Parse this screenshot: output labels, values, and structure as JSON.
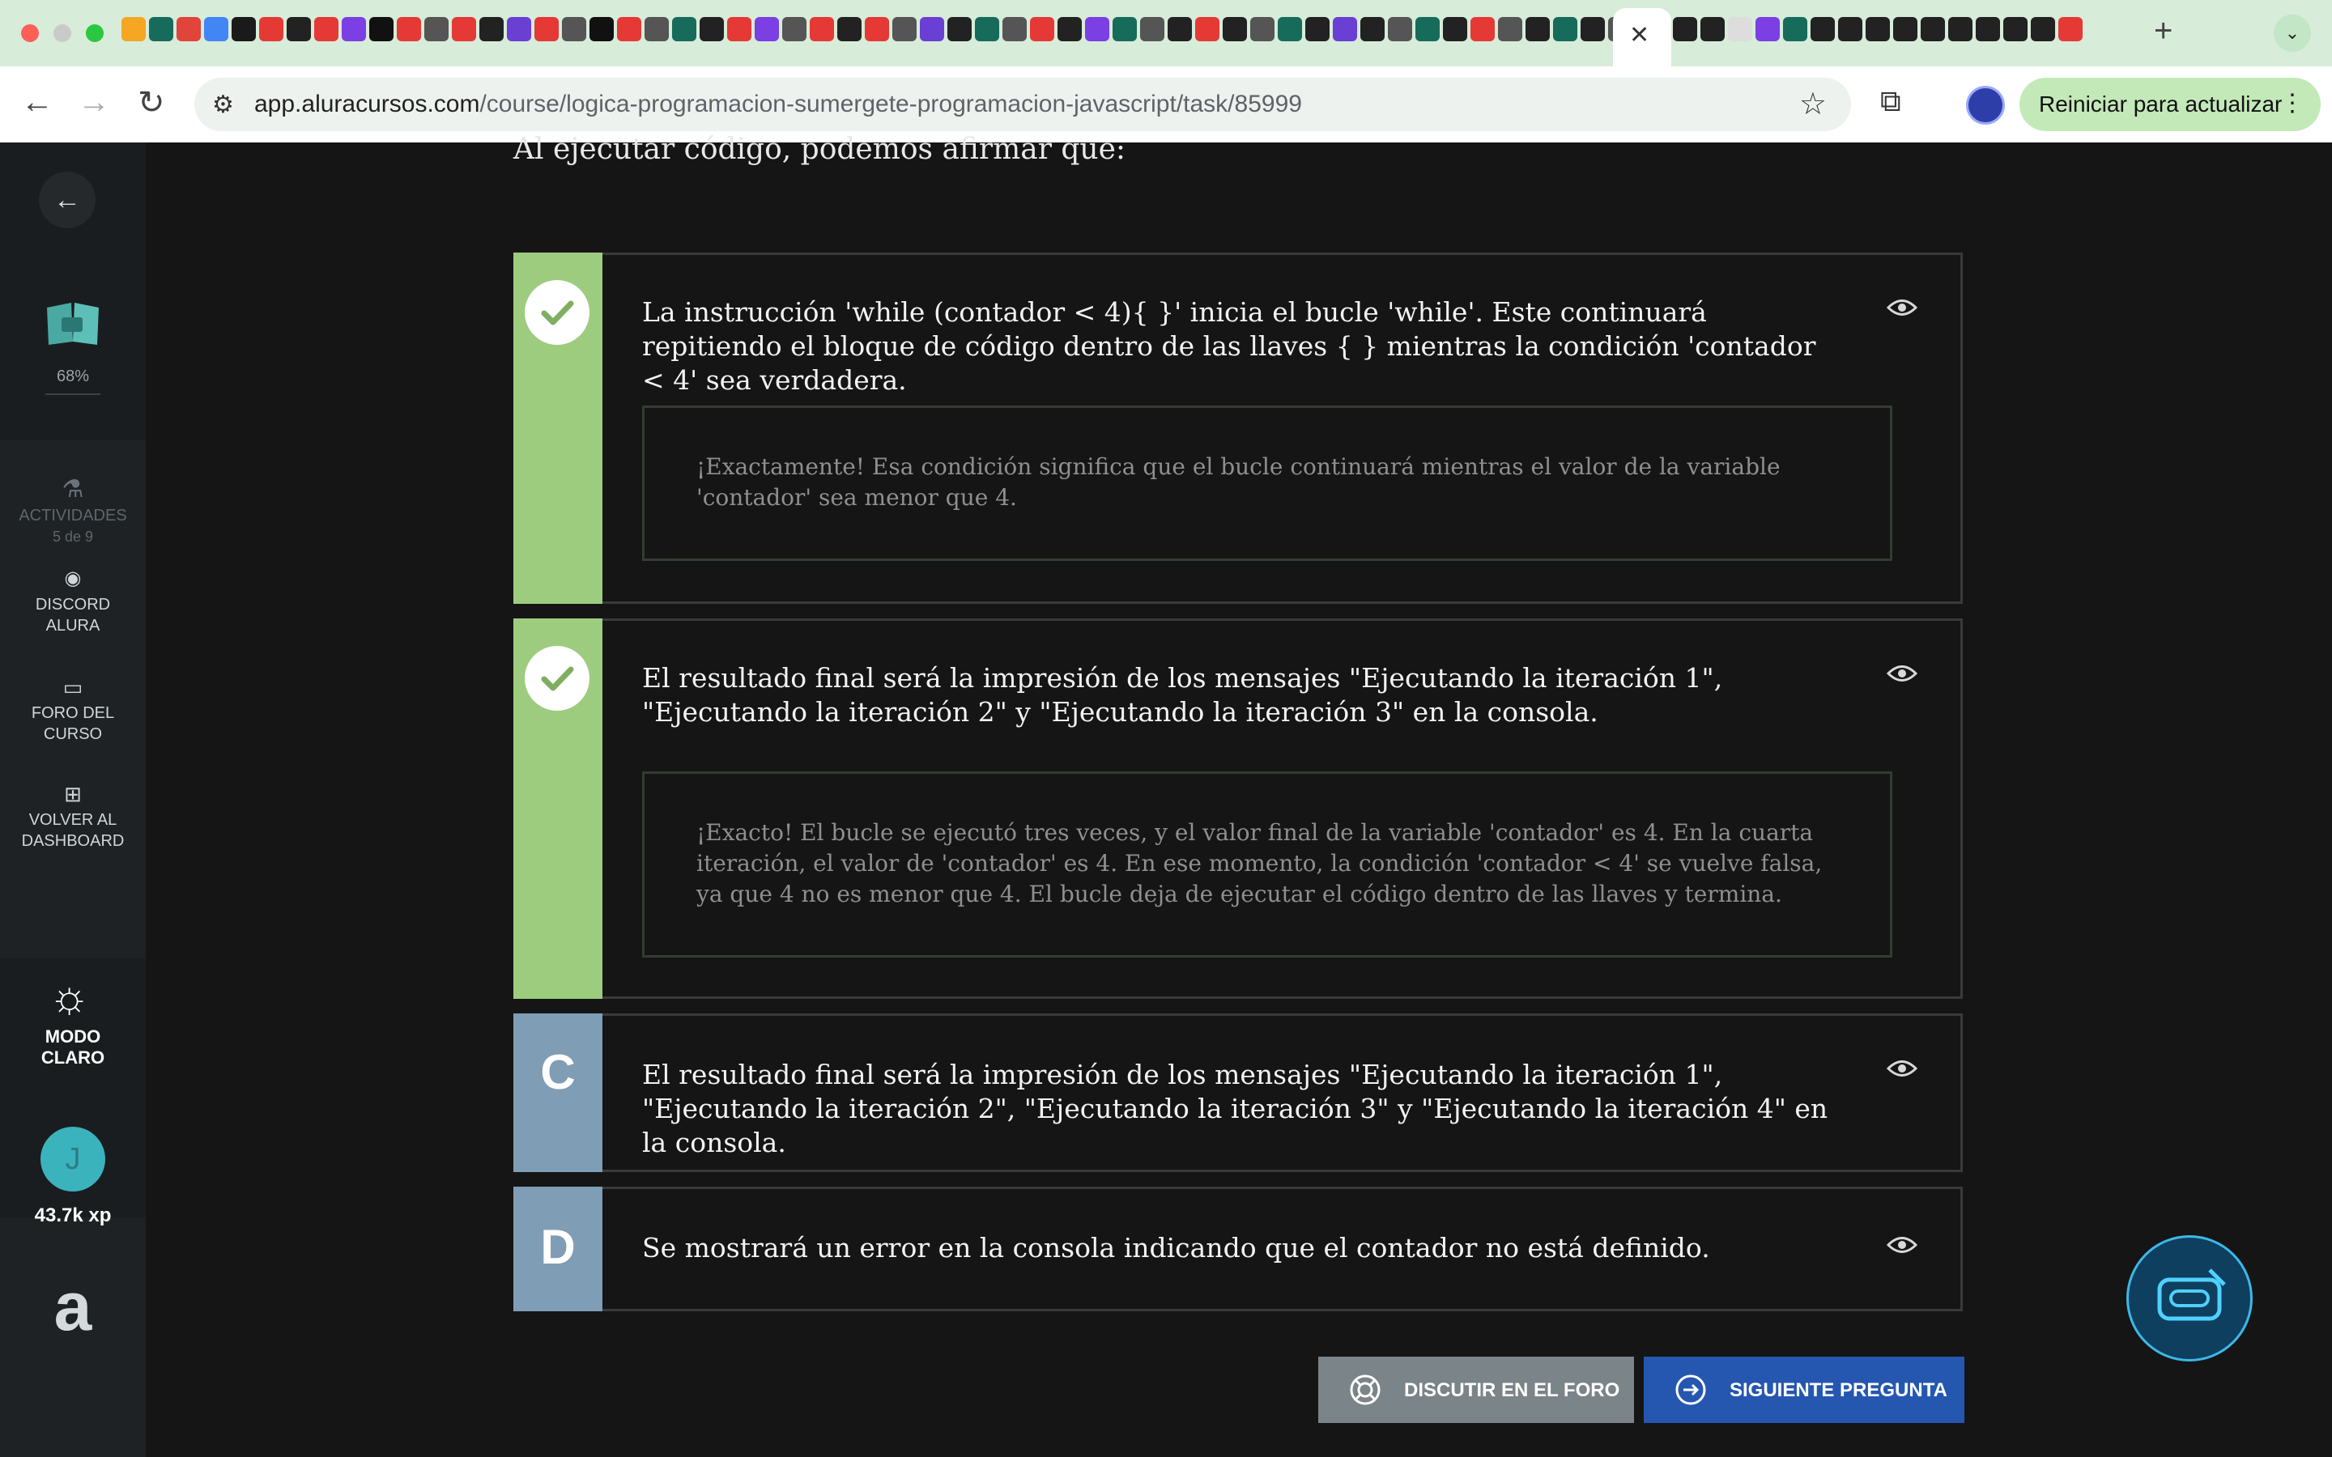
{
  "browser": {
    "url_host": "app.aluracursos.com",
    "url_path": "/course/logica-programacion-sumergete-programacion-javascript/task/85999",
    "restart_label": "Reiniciar para actualizar"
  },
  "sidebar": {
    "progress": "68%",
    "activities_label": "ACTIVIDADES",
    "activities_count": "5 de 9",
    "discord_label": "DISCORD ALURA",
    "forum_label": "FORO DEL CURSO",
    "dashboard_label": "VOLVER AL DASHBOARD",
    "mode_label": "MODO CLARO",
    "avatar_initial": "J",
    "xp": "43.7k xp",
    "logo": "a"
  },
  "question": {
    "prompt": "Al ejecutar código, podemos afirmar que:",
    "options": [
      {
        "marker": "",
        "text": "La instrucción 'while (contador < 4){ }' inicia el bucle 'while'. Este continuará repitiendo el bloque de código dentro de las llaves { } mientras la condición 'contador < 4' sea verdadera.",
        "feedback": "¡Exactamente! Esa condición significa que el bucle continuará mientras el valor de la variable 'contador' sea menor que 4.",
        "correct": true
      },
      {
        "marker": "",
        "text": "El resultado final será la impresión de los mensajes \"Ejecutando la iteración 1\", \"Ejecutando la iteración 2\" y \"Ejecutando la iteración 3\" en la consola.",
        "feedback": "¡Exacto! El bucle se ejecutó tres veces, y el valor final de la variable 'contador' es 4. En la cuarta iteración, el valor de 'contador' es 4. En ese momento, la condición 'contador < 4' se vuelve falsa, ya que 4 no es menor que 4. El bucle deja de ejecutar el código dentro de las llaves y termina.",
        "correct": true
      },
      {
        "marker": "C",
        "text": "El resultado final será la impresión de los mensajes \"Ejecutando la iteración 1\", \"Ejecutando la iteración 2\", \"Ejecutando la iteración 3\" y \"Ejecutando la iteración 4\" en la consola.",
        "feedback": "",
        "correct": false
      },
      {
        "marker": "D",
        "text": "Se mostrará un error en la consola indicando que el contador no está definido.",
        "feedback": "",
        "correct": false
      }
    ]
  },
  "actions": {
    "forum_button": "DISCUTIR EN EL FORO",
    "next_button": "SIGUIENTE PREGUNTA"
  },
  "colors": {
    "correct_green": "#9dcc7e",
    "letter_blue": "#7f9db5",
    "next_blue": "#2557b1"
  }
}
